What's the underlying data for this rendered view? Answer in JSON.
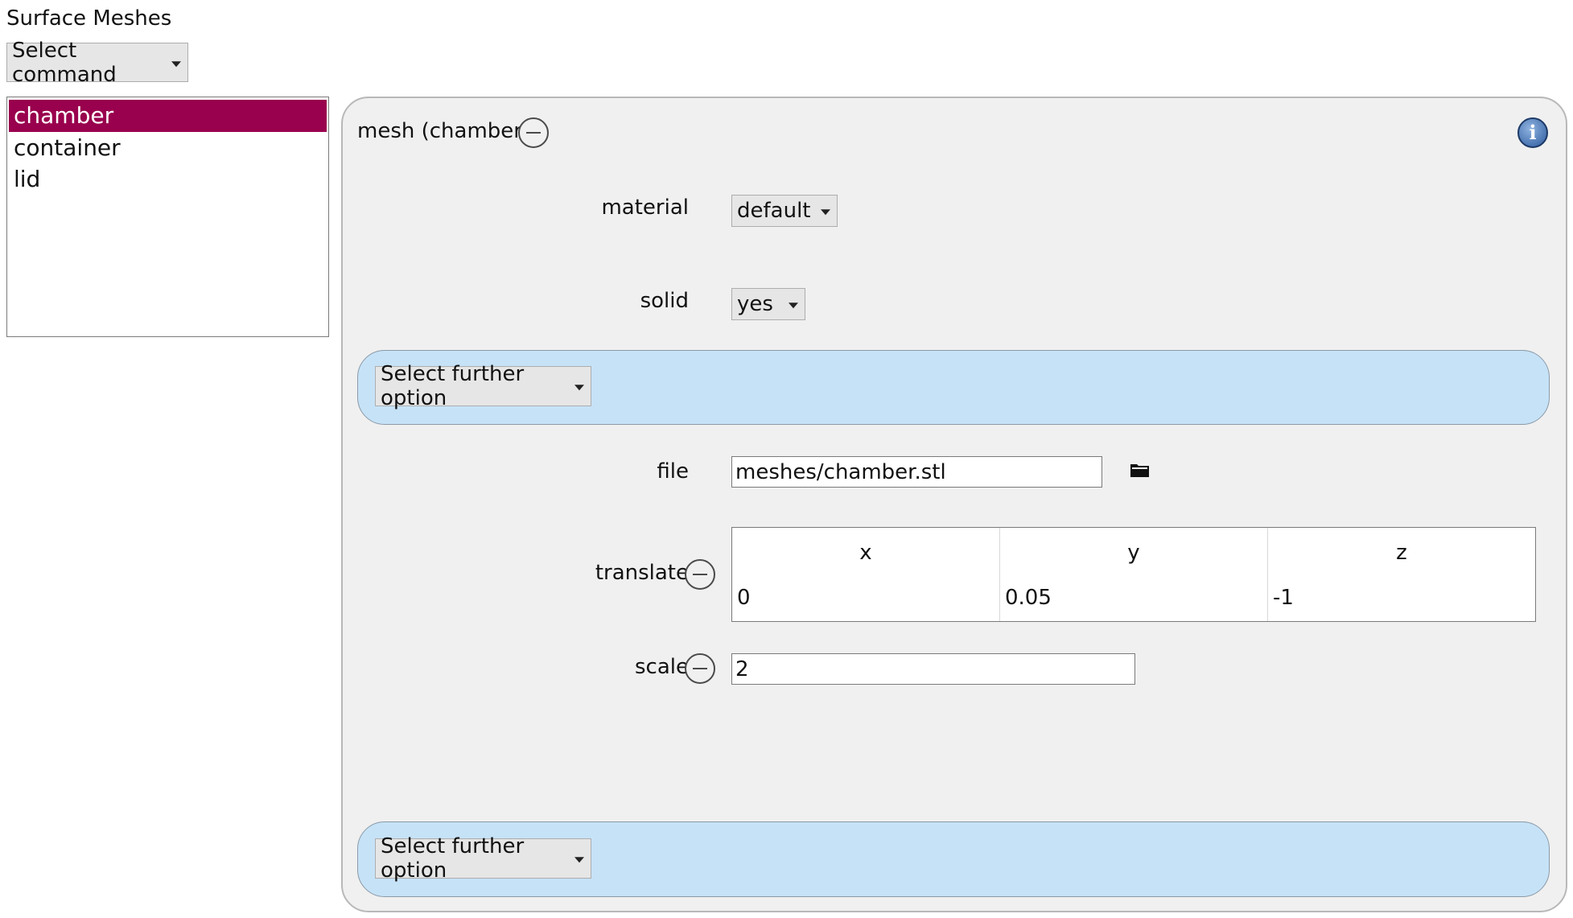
{
  "page": {
    "title": "Surface Meshes"
  },
  "command_select": {
    "value": "Select command"
  },
  "mesh_list": {
    "items": [
      "chamber",
      "container",
      "lid"
    ],
    "selected": "chamber"
  },
  "panel": {
    "title": "mesh (chamber)",
    "material": {
      "label": "material",
      "value": "default"
    },
    "solid": {
      "label": "solid",
      "value": "yes"
    },
    "further_option_top": {
      "value": "Select further option"
    },
    "file": {
      "label": "file",
      "value": "meshes/chamber.stl"
    },
    "translate": {
      "label": "translate",
      "headers": [
        "x",
        "y",
        "z"
      ],
      "values": [
        "0",
        "0.05",
        "-1"
      ]
    },
    "scale": {
      "label": "scale",
      "value": "2"
    },
    "further_option_bottom": {
      "value": "Select further option"
    }
  },
  "colors": {
    "selection": "#99004d",
    "option_box": "#c6e2f7",
    "panel_bg": "#f0f0f0"
  },
  "icons": [
    "info-icon",
    "minus-circle-icon",
    "folder-icon",
    "chevron-down-icon"
  ]
}
